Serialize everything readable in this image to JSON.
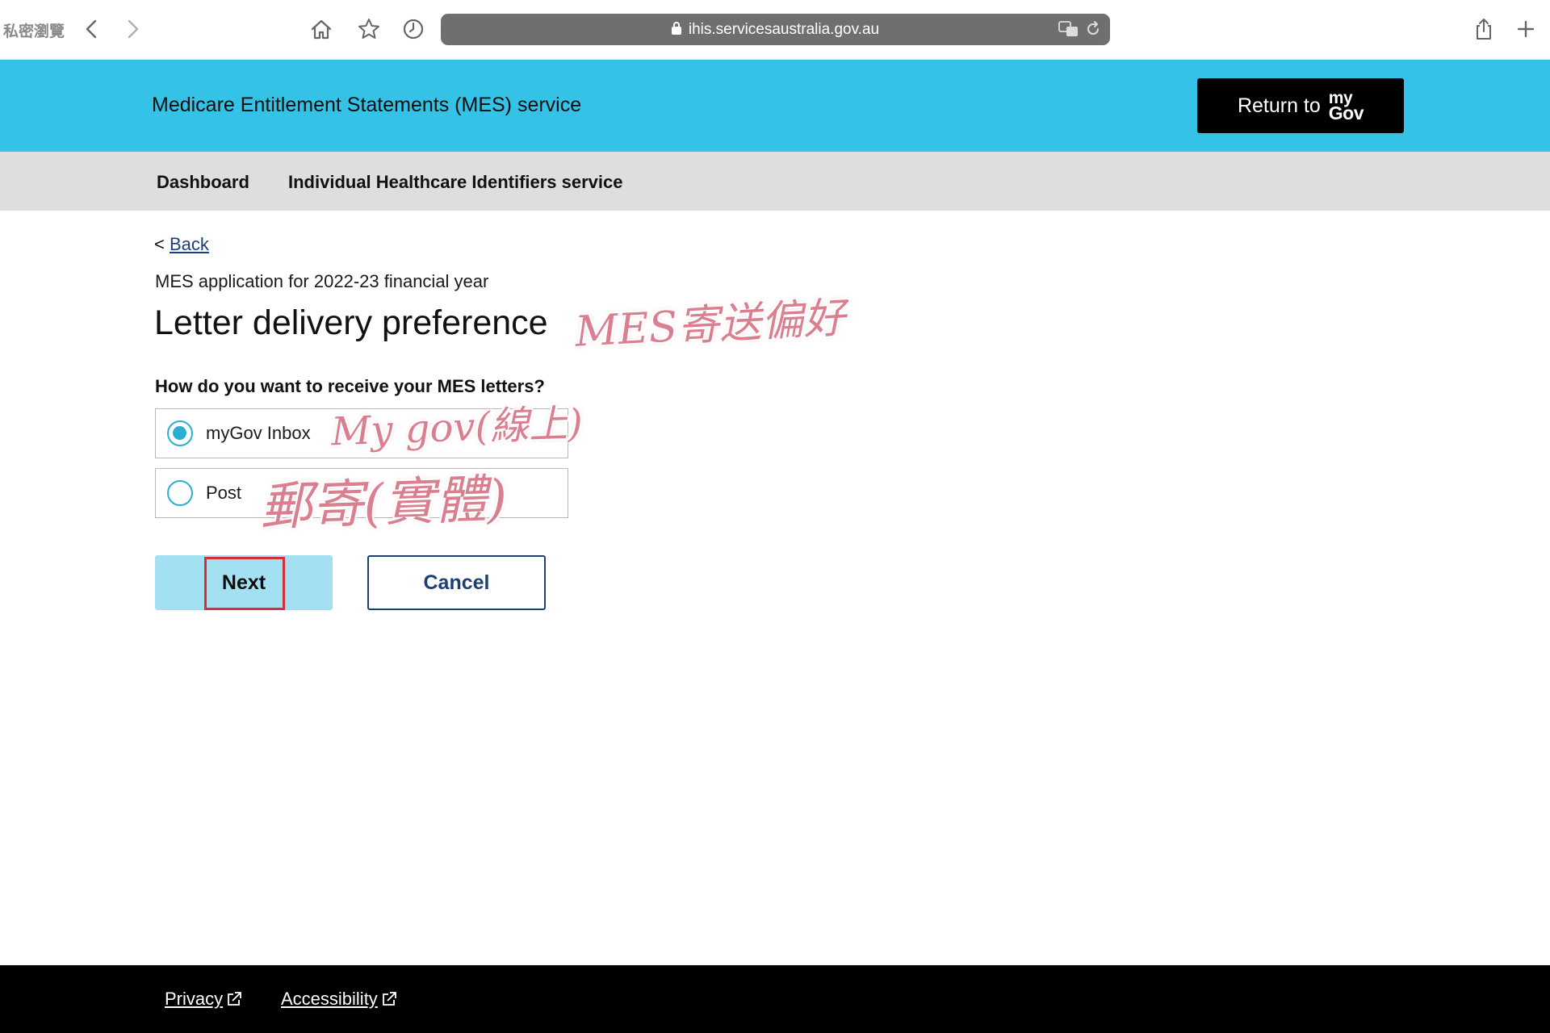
{
  "browser": {
    "private_label": "私密瀏覽",
    "url": "ihis.servicesaustralia.gov.au"
  },
  "header": {
    "title": "Medicare Entitlement Statements (MES) service",
    "return_label": "Return to",
    "mygov_my": "my",
    "mygov_gov": "Gov"
  },
  "nav": {
    "items": [
      {
        "label": "Dashboard"
      },
      {
        "label": "Individual Healthcare Identifiers service"
      }
    ]
  },
  "main": {
    "back_prefix": "<",
    "back_label": "Back",
    "subtitle": "MES application for 2022-23 financial year",
    "title": "Letter delivery preference",
    "question": "How do you want to receive your MES letters?",
    "options": [
      {
        "label": "myGov Inbox",
        "selected": true
      },
      {
        "label": "Post",
        "selected": false
      }
    ],
    "next_label": "Next",
    "cancel_label": "Cancel"
  },
  "annotations": {
    "title_note": "MES寄送偏好",
    "mygov_note": "My gov(線上)",
    "post_note": "郵寄(實體)"
  },
  "footer": {
    "links": [
      {
        "label": "Privacy"
      },
      {
        "label": "Accessibility"
      }
    ]
  },
  "colors": {
    "header_bg": "#34c2e6",
    "nav_bg": "#dedede",
    "next_bg": "#a3e0f2",
    "cancel_border": "#1c3f77",
    "radio": "#2aaed4",
    "annotation": "#d97f8f",
    "highlight": "#e02a3a",
    "footer_bg": "#000000"
  }
}
